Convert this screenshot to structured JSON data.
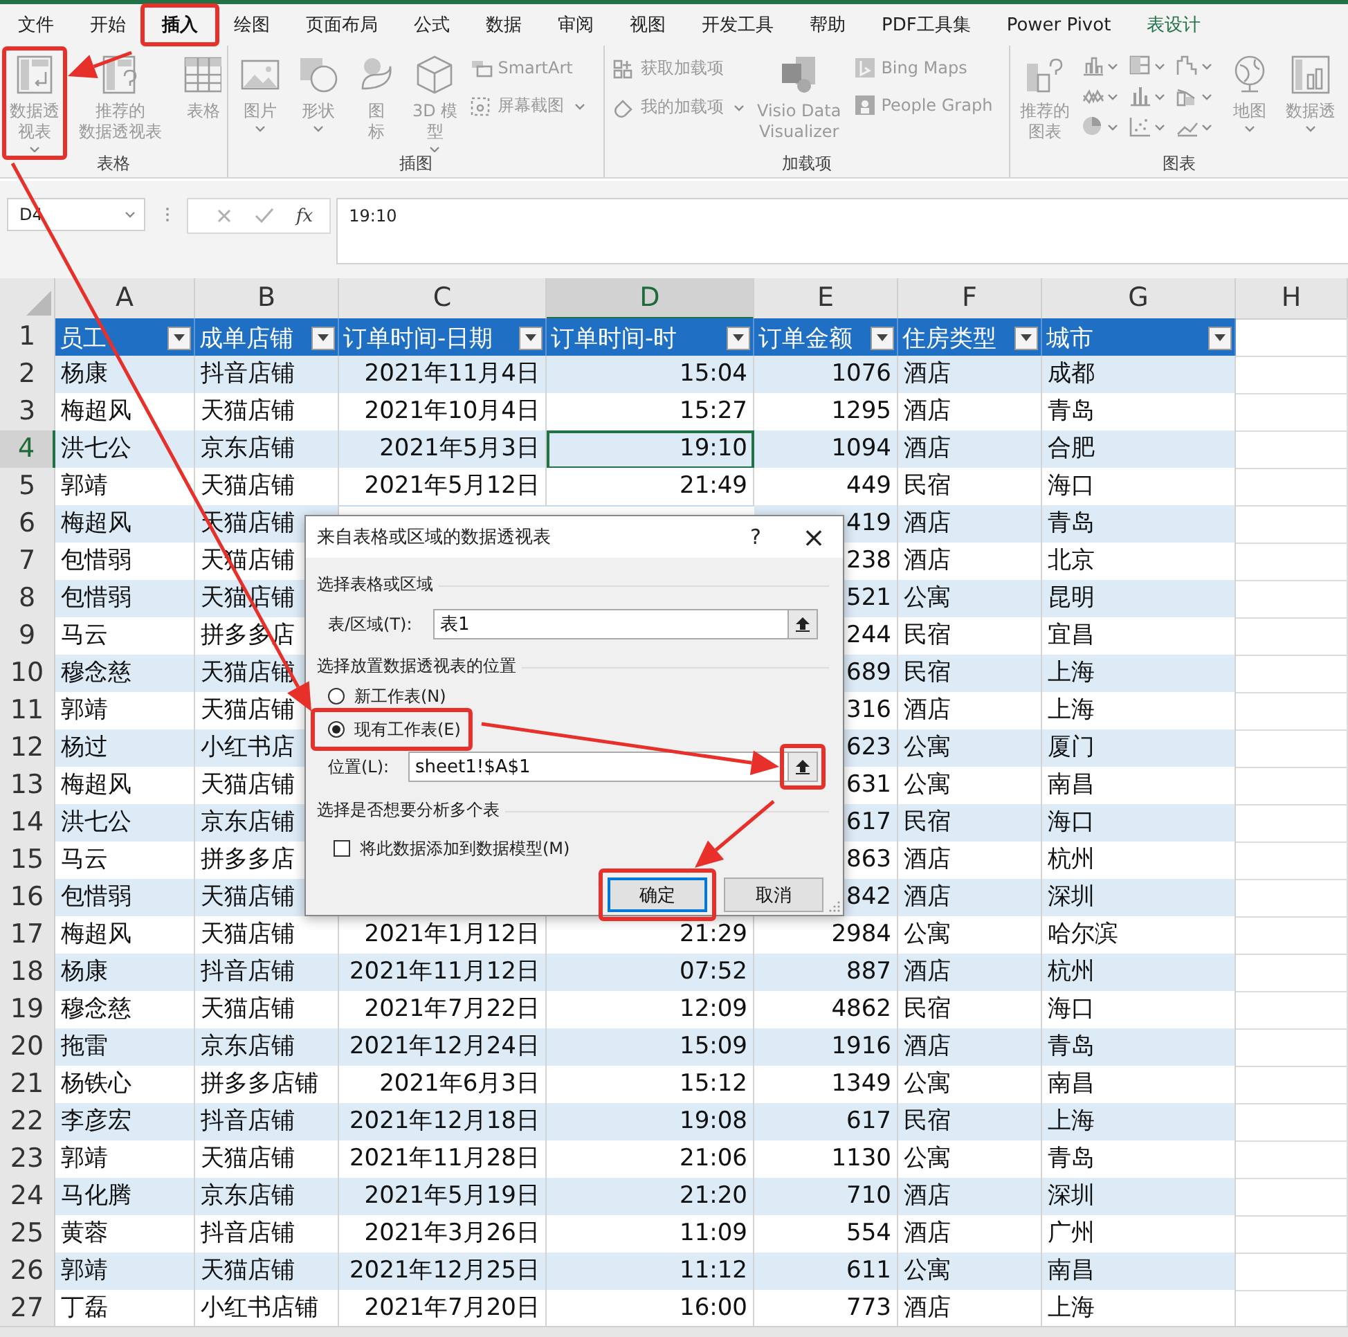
{
  "ribbon": {
    "tabs": [
      {
        "label": "文件",
        "selected": false,
        "kind": "normal"
      },
      {
        "label": "开始",
        "selected": false,
        "kind": "normal"
      },
      {
        "label": "插入",
        "selected": true,
        "kind": "normal"
      },
      {
        "label": "绘图",
        "selected": false,
        "kind": "normal"
      },
      {
        "label": "页面布局",
        "selected": false,
        "kind": "normal"
      },
      {
        "label": "公式",
        "selected": false,
        "kind": "normal"
      },
      {
        "label": "数据",
        "selected": false,
        "kind": "normal"
      },
      {
        "label": "审阅",
        "selected": false,
        "kind": "normal"
      },
      {
        "label": "视图",
        "selected": false,
        "kind": "normal"
      },
      {
        "label": "开发工具",
        "selected": false,
        "kind": "normal"
      },
      {
        "label": "帮助",
        "selected": false,
        "kind": "normal"
      },
      {
        "label": "PDF工具集",
        "selected": false,
        "kind": "normal"
      },
      {
        "label": "Power Pivot",
        "selected": false,
        "kind": "normal"
      },
      {
        "label": "表设计",
        "selected": false,
        "kind": "contextual"
      }
    ],
    "groups": [
      {
        "label": "表格",
        "items": [
          {
            "kind": "large",
            "lines": [
              "数据透",
              "视表"
            ],
            "dropdown": true
          },
          {
            "kind": "large",
            "lines": [
              "推荐的",
              "数据透视表"
            ],
            "dropdown": false
          },
          {
            "kind": "large",
            "lines": [
              "表格"
            ],
            "dropdown": false
          }
        ]
      },
      {
        "label": "插图",
        "items": [
          {
            "kind": "large",
            "lines": [
              "图片"
            ],
            "dropdown": true
          },
          {
            "kind": "large",
            "lines": [
              "形状"
            ],
            "dropdown": true
          },
          {
            "kind": "large",
            "lines": [
              "图",
              "标"
            ],
            "dropdown": false
          },
          {
            "kind": "large",
            "lines": [
              "3D 模",
              "型"
            ],
            "dropdown": true
          },
          {
            "kind": "stack",
            "items": [
              {
                "label": "SmartArt",
                "dropdown": false
              },
              {
                "label": "屏幕截图",
                "dropdown": true
              }
            ]
          }
        ]
      },
      {
        "label": "加载项",
        "items": [
          {
            "kind": "stack",
            "items": [
              {
                "label": "获取加载项",
                "dropdown": false
              },
              {
                "label": "我的加载项",
                "dropdown": true
              }
            ]
          },
          {
            "kind": "large",
            "lines": [
              "Visio Data",
              "Visualizer"
            ],
            "dropdown": false
          },
          {
            "kind": "stack",
            "items": [
              {
                "label": "Bing Maps",
                "dropdown": false
              },
              {
                "label": "People Graph",
                "dropdown": false
              }
            ]
          }
        ]
      },
      {
        "label": "图表",
        "items": [
          {
            "kind": "large",
            "lines": [
              "推荐的",
              "图表"
            ],
            "dropdown": false
          },
          {
            "kind": "chart-grid"
          },
          {
            "kind": "large",
            "lines": [
              "地图"
            ],
            "dropdown": true
          },
          {
            "kind": "large",
            "lines": [
              "数据透"
            ],
            "dropdown": true
          }
        ]
      }
    ]
  },
  "formula_bar": {
    "name_box": "D4",
    "function_label": "fx",
    "value": "19:10"
  },
  "sheet": {
    "columns": [
      {
        "label": "A",
        "selected": false
      },
      {
        "label": "B",
        "selected": false
      },
      {
        "label": "C",
        "selected": false
      },
      {
        "label": "D",
        "selected": true
      },
      {
        "label": "E",
        "selected": false
      },
      {
        "label": "F",
        "selected": false
      },
      {
        "label": "G",
        "selected": false
      },
      {
        "label": "H",
        "selected": false
      }
    ],
    "header_row": {
      "number": "1",
      "cells": [
        "员工",
        "成单店铺",
        "订单时间-日期",
        "订单时间-时",
        "订单金额",
        "住房类型",
        "城市"
      ]
    },
    "rows": [
      {
        "number": "2",
        "selected": false,
        "cells": [
          "杨康",
          "抖音店铺",
          "2021年11月4日",
          "15:04",
          "1076",
          "酒店",
          "成都"
        ]
      },
      {
        "number": "3",
        "selected": false,
        "cells": [
          "梅超风",
          "天猫店铺",
          "2021年10月4日",
          "15:27",
          "1295",
          "酒店",
          "青岛"
        ]
      },
      {
        "number": "4",
        "selected": true,
        "cells": [
          "洪七公",
          "京东店铺",
          "2021年5月3日",
          "19:10",
          "1094",
          "酒店",
          "合肥"
        ]
      },
      {
        "number": "5",
        "selected": false,
        "cells": [
          "郭靖",
          "天猫店铺",
          "2021年5月12日",
          "21:49",
          "449",
          "民宿",
          "海口"
        ]
      },
      {
        "number": "6",
        "selected": false,
        "cells": [
          "梅超风",
          "天猫店铺",
          null,
          null,
          "419",
          "酒店",
          "青岛"
        ]
      },
      {
        "number": "7",
        "selected": false,
        "cells": [
          "包惜弱",
          "天猫店铺",
          null,
          null,
          "238",
          "酒店",
          "北京"
        ]
      },
      {
        "number": "8",
        "selected": false,
        "cells": [
          "包惜弱",
          "天猫店铺",
          null,
          null,
          "521",
          "公寓",
          "昆明"
        ]
      },
      {
        "number": "9",
        "selected": false,
        "cells": [
          "马云",
          "拼多多店",
          null,
          null,
          "244",
          "民宿",
          "宜昌"
        ]
      },
      {
        "number": "10",
        "selected": false,
        "cells": [
          "穆念慈",
          "天猫店铺",
          null,
          null,
          "689",
          "民宿",
          "上海"
        ]
      },
      {
        "number": "11",
        "selected": false,
        "cells": [
          "郭靖",
          "天猫店铺",
          null,
          null,
          "316",
          "酒店",
          "上海"
        ]
      },
      {
        "number": "12",
        "selected": false,
        "cells": [
          "杨过",
          "小红书店",
          null,
          null,
          "623",
          "公寓",
          "厦门"
        ]
      },
      {
        "number": "13",
        "selected": false,
        "cells": [
          "梅超风",
          "天猫店铺",
          null,
          null,
          "631",
          "公寓",
          "南昌"
        ]
      },
      {
        "number": "14",
        "selected": false,
        "cells": [
          "洪七公",
          "京东店铺",
          null,
          null,
          "617",
          "民宿",
          "海口"
        ]
      },
      {
        "number": "15",
        "selected": false,
        "cells": [
          "马云",
          "拼多多店",
          null,
          null,
          "863",
          "酒店",
          "杭州"
        ]
      },
      {
        "number": "16",
        "selected": false,
        "cells": [
          "包惜弱",
          "天猫店铺",
          null,
          null,
          "842",
          "酒店",
          "深圳"
        ]
      },
      {
        "number": "17",
        "selected": false,
        "cells": [
          "梅超风",
          "天猫店铺",
          "2021年1月12日",
          "21:29",
          "2984",
          "公寓",
          "哈尔滨"
        ]
      },
      {
        "number": "18",
        "selected": false,
        "cells": [
          "杨康",
          "抖音店铺",
          "2021年11月12日",
          "07:52",
          "887",
          "酒店",
          "杭州"
        ]
      },
      {
        "number": "19",
        "selected": false,
        "cells": [
          "穆念慈",
          "天猫店铺",
          "2021年7月22日",
          "12:09",
          "4862",
          "民宿",
          "海口"
        ]
      },
      {
        "number": "20",
        "selected": false,
        "cells": [
          "拖雷",
          "京东店铺",
          "2021年12月24日",
          "15:09",
          "1916",
          "酒店",
          "青岛"
        ]
      },
      {
        "number": "21",
        "selected": false,
        "cells": [
          "杨铁心",
          "拼多多店铺",
          "2021年6月3日",
          "15:12",
          "1349",
          "公寓",
          "南昌"
        ]
      },
      {
        "number": "22",
        "selected": false,
        "cells": [
          "李彦宏",
          "抖音店铺",
          "2021年12月18日",
          "19:08",
          "617",
          "民宿",
          "上海"
        ]
      },
      {
        "number": "23",
        "selected": false,
        "cells": [
          "郭靖",
          "天猫店铺",
          "2021年11月28日",
          "21:06",
          "1130",
          "公寓",
          "青岛"
        ]
      },
      {
        "number": "24",
        "selected": false,
        "cells": [
          "马化腾",
          "京东店铺",
          "2021年5月19日",
          "21:20",
          "710",
          "酒店",
          "深圳"
        ]
      },
      {
        "number": "25",
        "selected": false,
        "cells": [
          "黄蓉",
          "抖音店铺",
          "2021年3月26日",
          "11:09",
          "554",
          "酒店",
          "广州"
        ]
      },
      {
        "number": "26",
        "selected": false,
        "cells": [
          "郭靖",
          "天猫店铺",
          "2021年12月25日",
          "11:12",
          "611",
          "公寓",
          "南昌"
        ]
      },
      {
        "number": "27",
        "selected": false,
        "cells": [
          "丁磊",
          "小红书店铺",
          "2021年7月20日",
          "16:00",
          "773",
          "酒店",
          "上海"
        ]
      }
    ]
  },
  "dialog": {
    "title": "来自表格或区域的数据透视表",
    "help": "?",
    "close": "×",
    "source": {
      "heading": "选择表格或区域",
      "label": "表/区域(T):",
      "value": "表1"
    },
    "placement": {
      "heading": "选择放置数据透视表的位置",
      "options": [
        {
          "label": "新工作表(N)",
          "selected": false
        },
        {
          "label": "现有工作表(E)",
          "selected": true
        }
      ],
      "label": "位置(L):",
      "value": "sheet1!$A$1"
    },
    "multiple": {
      "heading": "选择是否想要分析多个表",
      "checkbox": {
        "label": "将此数据添加到数据模型(M)",
        "checked": false
      }
    },
    "buttons": [
      {
        "label": "确定",
        "default": true
      },
      {
        "label": "取消",
        "default": false
      }
    ]
  }
}
